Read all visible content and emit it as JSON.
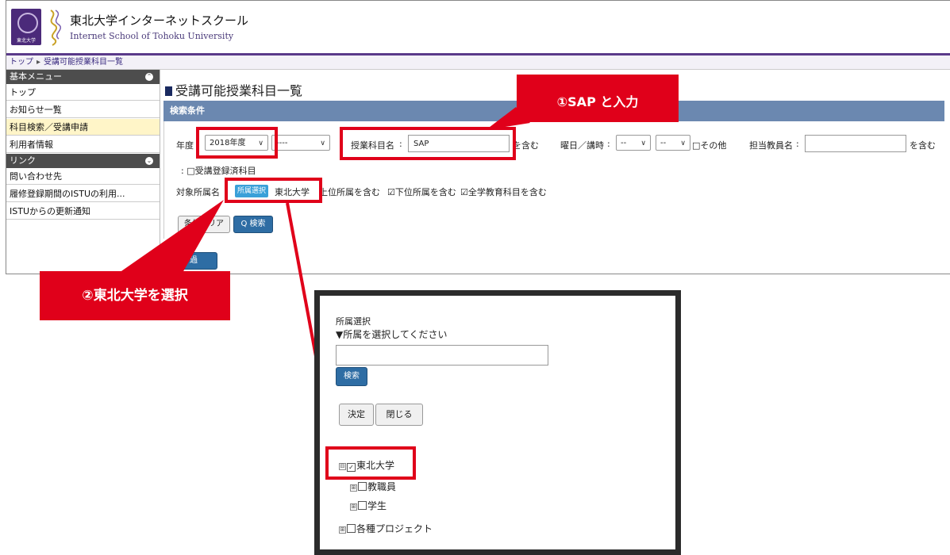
{
  "header": {
    "title_ja": "東北大学インターネットスクール",
    "title_en": "Internet School of Tohoku University",
    "logo_caption": "東北大学"
  },
  "breadcrumb": {
    "home": "トップ",
    "separator": "▸",
    "current": "受講可能授業科目一覧"
  },
  "sidebar": {
    "sections": [
      {
        "title": "基本メニュー",
        "toggle": "⌃",
        "items": [
          "トップ",
          "お知らせ一覧",
          "科目検索／受講申請",
          "利用者情報"
        ]
      },
      {
        "title": "リンク",
        "toggle": "⌄",
        "items": [
          "問い合わせ先",
          "履修登録期間のISTUの利用...",
          "ISTUからの更新通知"
        ]
      }
    ]
  },
  "main": {
    "title": "受講可能授業科目一覧",
    "panel_title": "検索条件",
    "year_label": "年度",
    "year_value": "2018年度",
    "term_value": "----",
    "subject_label": "授業科目名",
    "subject_value": "SAP",
    "contains": "を含む",
    "weekday_label": "曜日／講時",
    "weekday_value": "--",
    "period_value": "--",
    "other_label": "□その他",
    "teacher_label": "担当教員名",
    "teacher_contains": "を含む",
    "registered_label": "□受講登録済科目",
    "dept_label": "対象所属名",
    "dept_button": "所属選択",
    "dept_value": "東北大学",
    "include_upper": "上位所属を含む",
    "include_lower": "☑下位所属を含む",
    "include_general": "☑全学教育科目を含む",
    "clear_button": "条件クリア",
    "search_button": "Q 検索",
    "extra_button": "過"
  },
  "callouts": {
    "sap": "①SAP と入力",
    "tohoku": "②東北大学を選択"
  },
  "dialog": {
    "title": "所属選択",
    "hint": "▼所属を選択してください",
    "search_placeholder": "",
    "search_button": "検索",
    "decide_button": "決定",
    "close_button": "閉じる",
    "tree": [
      {
        "label": "東北大学",
        "checked": true,
        "expander": "⊟"
      },
      {
        "label": "教職員",
        "checked": false,
        "expander": "⊞"
      },
      {
        "label": "学生",
        "checked": false,
        "expander": "⊞"
      },
      {
        "label": "各種プロジェクト",
        "checked": false,
        "expander": "⊞"
      }
    ]
  },
  "colors": {
    "brand_purple": "#4b2a7a",
    "panel_blue": "#6b88b0",
    "highlight_red": "#e0001a",
    "button_blue": "#2e6da4"
  }
}
